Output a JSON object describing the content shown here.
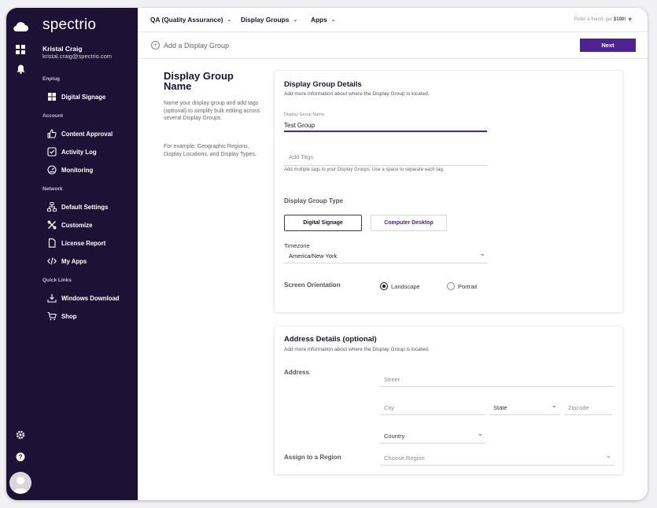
{
  "brand": "spectrio",
  "user": {
    "name": "Kristal Craig",
    "email": "kristal.craig@spectrio.com"
  },
  "nav": {
    "sections": [
      "Enplug",
      "Account",
      "Network",
      "Quick Links"
    ],
    "items": [
      {
        "label": "Digital Signage",
        "icon": "grid-icon"
      },
      {
        "label": "Content Approval",
        "icon": "thumbs-up-icon"
      },
      {
        "label": "Activity Log",
        "icon": "checkbox-icon"
      },
      {
        "label": "Monitoring",
        "icon": "speedometer-icon"
      },
      {
        "label": "Default Settings",
        "icon": "network-icon"
      },
      {
        "label": "Customize",
        "icon": "tools-icon"
      },
      {
        "label": "License Report",
        "icon": "document-icon"
      },
      {
        "label": "My Apps",
        "icon": "code-icon"
      },
      {
        "label": "Windows Download",
        "icon": "download-icon"
      },
      {
        "label": "Shop",
        "icon": "cart-icon"
      }
    ]
  },
  "topbar": {
    "menus": [
      "QA (Quality Assurance)",
      "Display Groups",
      "Apps"
    ],
    "refer_text": "Refer a friend, get",
    "refer_amount": "$100!"
  },
  "subbar": {
    "title": "Add a Display Group",
    "next_label": "Next"
  },
  "intro": {
    "title": "Display Group Name",
    "description": "Name your display group and add tags (optional) to simplify bulk editing across several Display Groups.",
    "example": "For example: Geographic Regions, Display Locations, and Display Types."
  },
  "details": {
    "title": "Display Group Details",
    "subtitle": "Add more information about where the Display Group is located.",
    "name_label": "Display Group Name",
    "name_value": "Test Group",
    "tags_placeholder": "Add Tags",
    "tags_hint": "Add multiple tags to your Display Groups. Use a space to separate each tag.",
    "type_heading": "Display Group Type",
    "type_options": [
      "Digital Signage",
      "Computer Desktop"
    ],
    "timezone_label": "Timezone",
    "timezone_value": "America/New York",
    "orientation_heading": "Screen Orientation",
    "orientation_options": [
      "Landscape",
      "Portrait"
    ],
    "orientation_selected": "Landscape"
  },
  "address": {
    "title": "Address Details (optional)",
    "subtitle": "Add more information about where the Display Group is located.",
    "address_label": "Address",
    "street_placeholder": "Street",
    "city_placeholder": "City",
    "state_value": "State",
    "zip_placeholder": "Zipcode",
    "country_value": "Country",
    "region_label": "Assign to a Region",
    "region_placeholder": "Choose Region"
  },
  "colors": {
    "sidebar": "#1d1135",
    "accent": "#4f2194",
    "heart": "#e0475a"
  }
}
